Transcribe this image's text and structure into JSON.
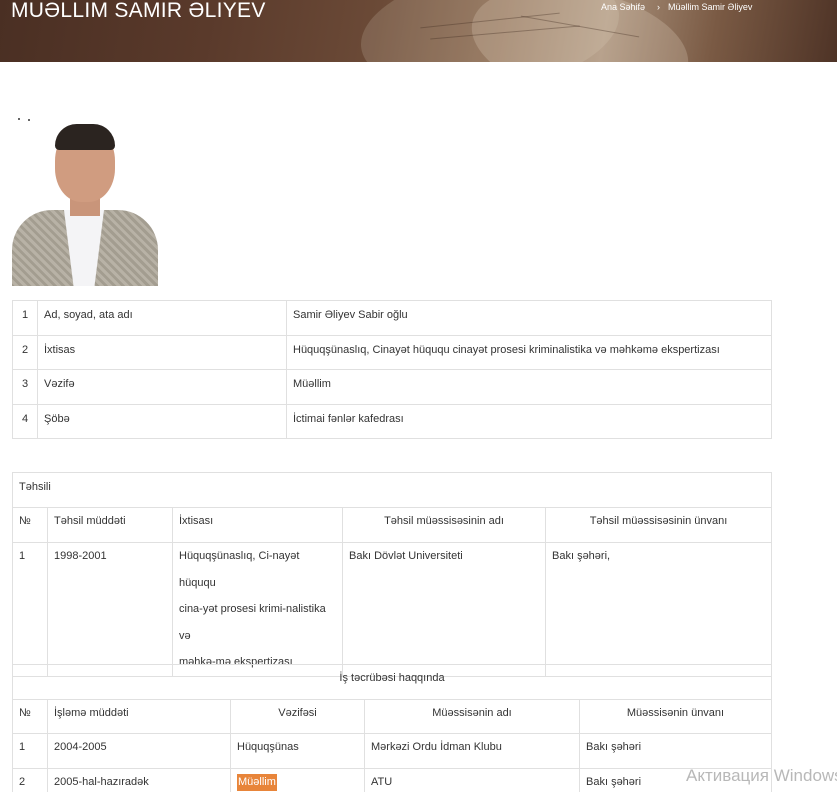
{
  "header": {
    "title": "MUƏLLIM SAMIR ƏLIYEV",
    "breadcrumb": {
      "home": "Ana Səhifə",
      "separator": "›",
      "current": "Müəllim Samir Əliyev"
    }
  },
  "profile": {
    "rows": [
      {
        "num": "1",
        "label": "Ad, soyad, ata adı",
        "value": "Samir Əliyev Sabir oğlu"
      },
      {
        "num": "2",
        "label": "İxtisas",
        "value": "Hüquqşünaslıq, Cinayət hüququ cinayət prosesi kriminalistika və məhkəmə ekspertizası"
      },
      {
        "num": "3",
        "label": "Vəzifə",
        "value": "Müəllim"
      },
      {
        "num": "4",
        "label": "Şöbə",
        "value": "İctimai fənlər kafedrası"
      }
    ]
  },
  "education": {
    "caption": "Təhsili",
    "headers": [
      "№",
      "Təhsil müddəti",
      "İxtisası",
      "Təhsil müəssisəsinin adı",
      "Təhsil müəssisəsinin ünvanı"
    ],
    "rows": [
      {
        "num": "1",
        "period": "1998-2001",
        "specialty_lines": [
          "Hüquqşünaslıq, Ci-nayət hüququ",
          "cina-yət prosesi krimi-nalistika və",
          "məhkə-mə ekspertizası"
        ],
        "institution": "Bakı Dövlət Universiteti",
        "address": "Bakı şəhəri,"
      }
    ]
  },
  "work": {
    "caption": "İş təcrübəsi haqqında",
    "headers": [
      "№",
      "İşləmə müddəti",
      "Vəzifəsi",
      "Müəssisənin adı",
      "Müəssisənin ünvanı"
    ],
    "rows": [
      {
        "num": "1",
        "period": "2004-2005",
        "position": "Hüquqşünas",
        "org": "Mərkəzi Ordu İdman Klubu",
        "address": "Bakı şəhəri"
      },
      {
        "num": "2",
        "period": "2005-hal-hazıradək",
        "position": "Müəllim",
        "org": "ATU",
        "address": "Bakı şəhəri"
      }
    ]
  },
  "watermark": "Активация Windows",
  "colors": {
    "highlight": "#e8853a",
    "border": "#e0e0e0",
    "banner": "#5a3a2b"
  }
}
